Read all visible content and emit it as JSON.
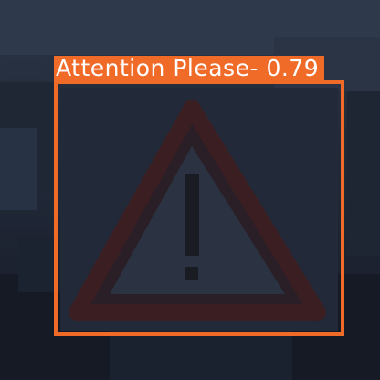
{
  "detection": {
    "label": "Attention Please-",
    "confidence": "0.79",
    "box_color": "#f06a28",
    "label_text_color": "#ffffff"
  }
}
